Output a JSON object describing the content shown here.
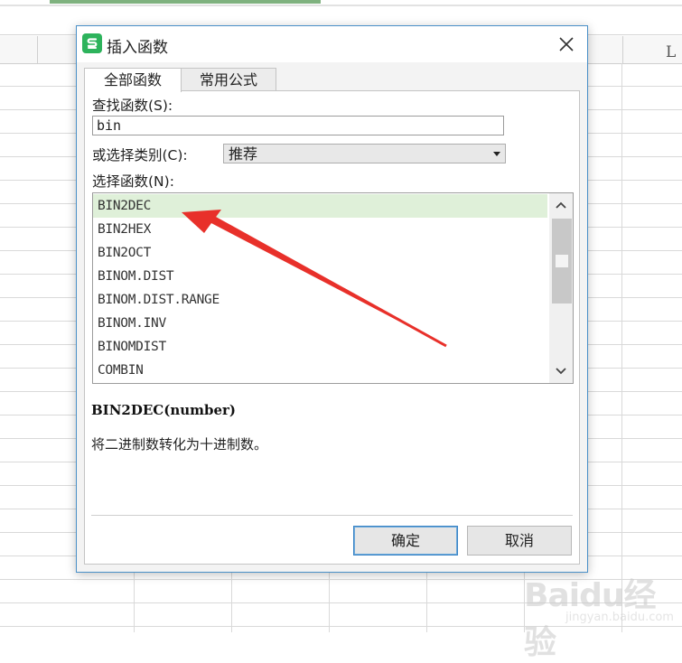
{
  "dialog": {
    "title": "插入函数",
    "tabs": [
      {
        "label": "全部函数",
        "active": true
      },
      {
        "label": "常用公式",
        "active": false
      }
    ],
    "search": {
      "label": "查找函数(S):",
      "value": "bin"
    },
    "category": {
      "label": "或选择类别(C):",
      "value": "推荐"
    },
    "function_list": {
      "label": "选择函数(N):",
      "items": [
        "BIN2DEC",
        "BIN2HEX",
        "BIN2OCT",
        "BINOM.DIST",
        "BINOM.DIST.RANGE",
        "BINOM.INV",
        "BINOMDIST",
        "COMBIN"
      ],
      "selected": "BIN2DEC"
    },
    "signature": "BIN2DEC(number)",
    "description": "将二进制数转化为十进制数。",
    "buttons": {
      "ok": "确定",
      "cancel": "取消"
    }
  },
  "sheet": {
    "column_letter": "L"
  },
  "watermark": {
    "text": "Baidu经验",
    "sub": "jingyan.baidu.com"
  },
  "colors": {
    "selected_row": "#dff0d9",
    "dialog_border": "#4a90c8",
    "app_icon": "#2db35c",
    "annotation_arrow": "#e8302a"
  },
  "icons": [
    "wps-spreadsheet-icon",
    "close-icon",
    "chevron-up-icon",
    "chevron-down-icon",
    "dropdown-arrow-icon"
  ]
}
